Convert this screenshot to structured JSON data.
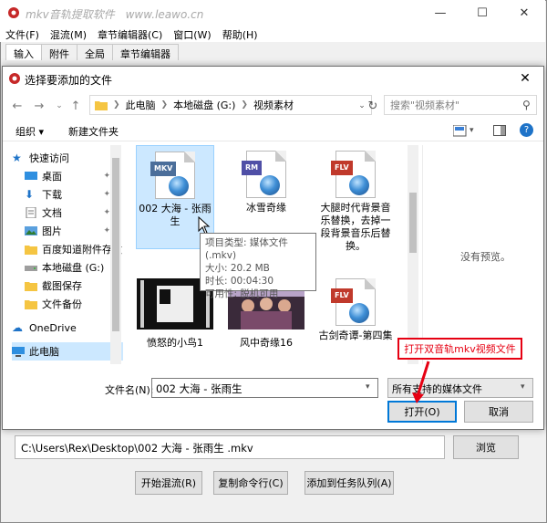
{
  "app": {
    "title": "mkv音轨提取软件",
    "url": "www.leawo.cn",
    "menu": [
      "文件(F)",
      "混流(M)",
      "章节编辑器(C)",
      "窗口(W)",
      "帮助(H)"
    ],
    "tabs": [
      "输入",
      "附件",
      "全局",
      "章节编辑器"
    ],
    "path_value": "C:\\Users\\Rex\\Desktop\\002 大海 - 张雨生 .mkv",
    "browse_label": "浏览",
    "start_mux_label": "开始混流(R)",
    "copy_cmd_label": "复制命令行(C)",
    "add_queue_label": "添加到任务队列(A)"
  },
  "dialog": {
    "title": "选择要添加的文件",
    "breadcrumb": [
      "此电脑",
      "本地磁盘 (G:)",
      "视频素材"
    ],
    "search_placeholder": "搜索\"视频素材\"",
    "organize_label": "组织 ▾",
    "new_folder_label": "新建文件夹",
    "nav": [
      {
        "label": "快速访问",
        "icon": "star-icon"
      },
      {
        "label": "桌面",
        "icon": "desktop-icon",
        "pinned": true
      },
      {
        "label": "下载",
        "icon": "download-icon",
        "pinned": true
      },
      {
        "label": "文档",
        "icon": "document-icon",
        "pinned": true
      },
      {
        "label": "图片",
        "icon": "picture-icon",
        "pinned": true
      },
      {
        "label": "百度知道附件存放",
        "icon": "folder-icon"
      },
      {
        "label": "本地磁盘 (G:)",
        "icon": "drive-icon"
      },
      {
        "label": "截图保存",
        "icon": "folder-icon"
      },
      {
        "label": "文件备份",
        "icon": "folder-icon"
      },
      {
        "label": "OneDrive",
        "icon": "cloud-icon"
      },
      {
        "label": "此电脑",
        "icon": "computer-icon"
      }
    ],
    "files": [
      {
        "name": "002 大海 - 张雨生",
        "type": "MKV",
        "color": "#4b6e9a"
      },
      {
        "name": "冰雪奇缘",
        "type": "RM",
        "color": "#4f4fa6"
      },
      {
        "name": "大腿时代背景音乐替换，去掉一段背景音乐后替换。",
        "type": "FLV",
        "color": "#c0392b"
      },
      {
        "name": "愤怒的小鸟1",
        "type": "thumb"
      },
      {
        "name": "风中奇缘16",
        "type": "thumb"
      },
      {
        "name": "古剑奇谭-第四集",
        "type": "FLV",
        "color": "#c0392b"
      }
    ],
    "tooltip": [
      "项目类型: 媒体文件(.mkv)",
      "大小: 20.2 MB",
      "时长: 00:04:30",
      "可用性: 脱机可用"
    ],
    "no_preview": "没有预览。",
    "filename_label": "文件名(N):",
    "filename_value": "002 大海 - 张雨生",
    "filter_value": "所有支持的媒体文件",
    "open_label": "打开(O)",
    "cancel_label": "取消"
  },
  "callout": "打开双音轨mkv视频文件",
  "colors": {
    "accent": "#0078d7",
    "selection": "#cce8ff",
    "callout": "#e60012"
  }
}
